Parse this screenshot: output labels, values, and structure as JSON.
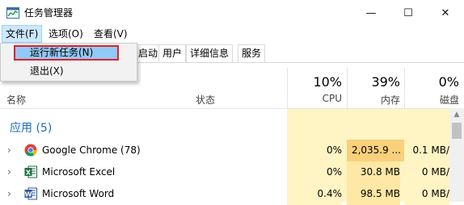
{
  "window": {
    "title": "任务管理器",
    "min_glyph": "—",
    "max_glyph": "☐",
    "close_glyph": "✕"
  },
  "menu": {
    "file": "文件(F)",
    "options": "选项(O)",
    "view": "查看(V)"
  },
  "file_menu": {
    "run_new_task": "运行新任务(N)",
    "exit": "退出(X)"
  },
  "tabs": {
    "startup": "启动",
    "users": "用户",
    "details": "详细信息",
    "services": "服务"
  },
  "header": {
    "name": "名称",
    "status": "状态",
    "cpu_pct": "10%",
    "cpu": "CPU",
    "mem_pct": "39%",
    "mem": "内存",
    "disk_pct": "0%",
    "disk": "磁盘"
  },
  "groups": {
    "apps": "应用 (5)"
  },
  "rows": [
    {
      "name": "Google Chrome (78)",
      "cpu": "0%",
      "mem": "2,035.9 ...",
      "disk": "0.1 MB/",
      "icon": "chrome-icon"
    },
    {
      "name": "Microsoft Excel",
      "cpu": "0%",
      "mem": "30.8 MB",
      "disk": "0 MB/",
      "icon": "excel-icon"
    },
    {
      "name": "Microsoft Word",
      "cpu": "0.4%",
      "mem": "98.5 MB",
      "disk": "0 MB/",
      "icon": "word-icon"
    }
  ],
  "colors": {
    "accent": "#1e6bb8",
    "usage_light": "#fff4c4",
    "usage_mid": "#ffe8a6",
    "usage_high": "#f9d07b",
    "highlight": "#e0202a",
    "menu_selected": "#91c9f7"
  }
}
